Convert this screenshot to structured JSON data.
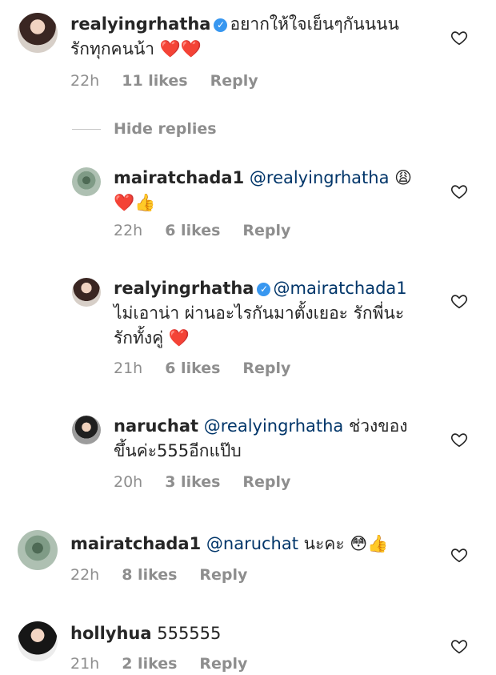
{
  "comments": [
    {
      "user": "realyingrhatha",
      "verified": true,
      "mention": "",
      "text": "อยากให้ใจเย็นๆกันนนน รักทุกคนน้า ",
      "emoji": "❤️❤️",
      "time": "22h",
      "likes": "11 likes",
      "reply": "Reply"
    },
    {
      "user": "mairatchada1",
      "verified": false,
      "mention": "@realyingrhatha",
      "text": " 😩",
      "emoji": "❤️👍",
      "time": "22h",
      "likes": "6 likes",
      "reply": "Reply"
    },
    {
      "user": "realyingrhatha",
      "verified": true,
      "mention": "@mairatchada1",
      "text": " ไม่เอาน่า ผ่านอะไรกันมาตั้งเยอะ รักพี่นะ รักทั้งคู่ ",
      "emoji": "❤️",
      "time": "21h",
      "likes": "6 likes",
      "reply": "Reply"
    },
    {
      "user": "naruchat",
      "verified": false,
      "mention": "@realyingrhatha",
      "text": "  ช่วงของขึ้นค่ะ555อีกแป๊บ",
      "emoji": "",
      "time": "20h",
      "likes": "3 likes",
      "reply": "Reply"
    },
    {
      "user": "mairatchada1",
      "verified": false,
      "mention": "@naruchat",
      "text": " นะคะ ",
      "emoji": "😳👍",
      "time": "22h",
      "likes": "8 likes",
      "reply": "Reply"
    },
    {
      "user": "hollyhua",
      "verified": false,
      "mention": "",
      "text": " 555555",
      "emoji": "",
      "time": "21h",
      "likes": "2 likes",
      "reply": "Reply"
    }
  ],
  "hide_replies": "Hide replies",
  "icons": {
    "verified": "verified-badge-icon",
    "like": "heart-outline-icon"
  },
  "colors": {
    "mention": "#003569",
    "meta": "#8e8e8e",
    "verified": "#3897f0"
  }
}
